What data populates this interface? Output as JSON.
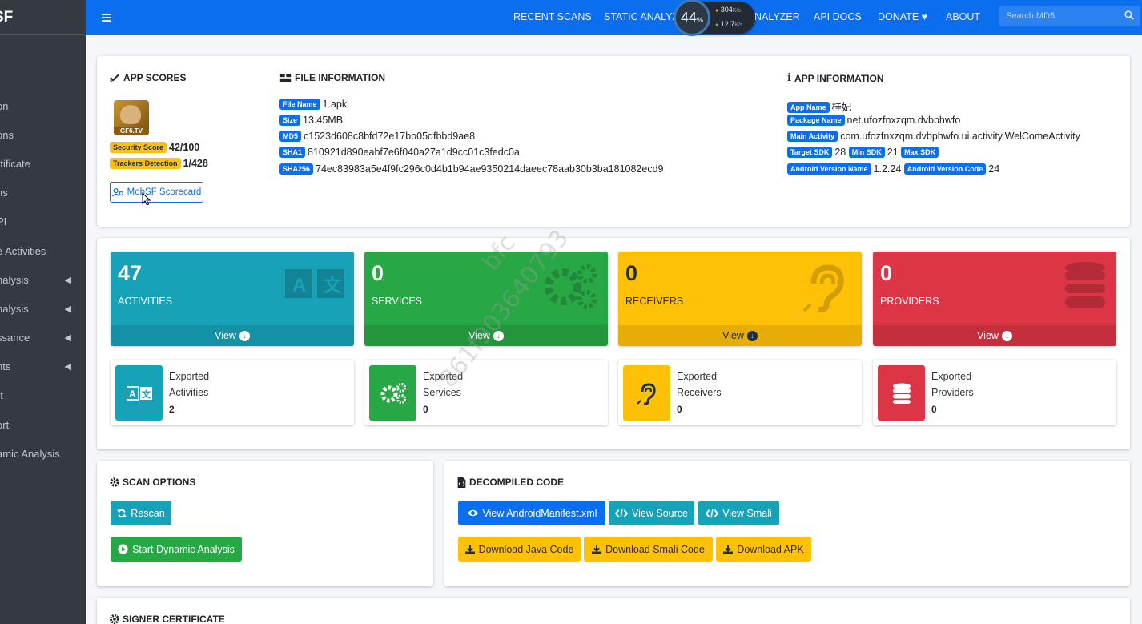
{
  "sidebar": {
    "brand": "SF",
    "items": [
      {
        "label": "on",
        "chevron": false
      },
      {
        "label": "ons",
        "chevron": false
      },
      {
        "label": "rtificate",
        "chevron": false
      },
      {
        "label": "ns",
        "chevron": false
      },
      {
        "label": "PI",
        "chevron": false
      },
      {
        "label": "e Activities",
        "chevron": false
      },
      {
        "label": "nalysis",
        "chevron": true
      },
      {
        "label": "nalysis",
        "chevron": true
      },
      {
        "label": "ssance",
        "chevron": true
      },
      {
        "label": "nts",
        "chevron": true
      },
      {
        "label": "rt",
        "chevron": false
      },
      {
        "label": "ort",
        "chevron": false
      },
      {
        "label": "amic Analysis",
        "chevron": false
      }
    ]
  },
  "topnav": {
    "recent_scans": "RECENT SCANS",
    "static_analyzer": "STATIC ANALYZE",
    "dynamic_analyzer": "NALYZER",
    "api_docs": "API DOCS",
    "donate": "DONATE",
    "about": "ABOUT",
    "search_placeholder": "Search MD5"
  },
  "speed_widget": {
    "percent": "44",
    "percent_unit": "%",
    "up": "304",
    "up_unit": "K/s",
    "down": "12.7",
    "down_unit": "K/s"
  },
  "app_scores": {
    "title": "APP SCORES",
    "icon_text": "GF6.TV",
    "security_label": "Security Score",
    "security_value": "42/100",
    "trackers_label": "Trackers Detection",
    "trackers_value": "1/428",
    "scorecard_button": "MobSF Scorecard"
  },
  "file_info": {
    "title": "FILE INFORMATION",
    "file_name_label": "File Name",
    "file_name": "1.apk",
    "size_label": "Size",
    "size": "13.45MB",
    "md5_label": "MD5",
    "md5": "c1523d608c8bfd72e17bb05dfbbd9ae8",
    "sha1_label": "SHA1",
    "sha1": "810921d890eabf7e6f040a27a1d9cc01c3fedc0a",
    "sha256_label": "SHA256",
    "sha256": "74ec83983a5e4f9fc296c0d4b1b94ae9350214daeec78aab30b3ba181082ecd9"
  },
  "app_info": {
    "title": "APP INFORMATION",
    "app_name_label": "App Name",
    "app_name": "桂妃",
    "package_label": "Package Name",
    "package": "net.ufozfnxzqm.dvbphwfo",
    "main_activity_label": "Main Activity",
    "main_activity": "com.ufozfnxzqm.dvbphwfo.ui.activity.WelComeActivity",
    "target_sdk_label": "Target SDK",
    "target_sdk": "28",
    "min_sdk_label": "Min SDK",
    "min_sdk": "21",
    "max_sdk_label": "Max SDK",
    "max_sdk": "",
    "version_name_label": "Android Version Name",
    "version_name": "1.2.24",
    "version_code_label": "Android Version Code",
    "version_code": "24"
  },
  "components": {
    "view_label": "View",
    "activities": {
      "count": "47",
      "label": "ACTIVITIES",
      "color": "#17a2b8"
    },
    "services": {
      "count": "0",
      "label": "SERVICES",
      "color": "#28a745"
    },
    "receivers": {
      "count": "0",
      "label": "RECEIVERS",
      "color": "#ffc107"
    },
    "providers": {
      "count": "0",
      "label": "PROVIDERS",
      "color": "#dc3545"
    }
  },
  "exported": {
    "label": "Exported",
    "activities": {
      "kind": "Activities",
      "value": "2"
    },
    "services": {
      "kind": "Services",
      "value": "0"
    },
    "receivers": {
      "kind": "Receivers",
      "value": "0"
    },
    "providers": {
      "kind": "Providers",
      "value": "0"
    }
  },
  "scan_options": {
    "title": "SCAN OPTIONS",
    "rescan": "Rescan",
    "start_dynamic": "Start Dynamic Analysis"
  },
  "decompiled": {
    "title": "DECOMPILED CODE",
    "view_manifest": "View AndroidManifest.xml",
    "view_source": "View Source",
    "view_smali": "View Smali",
    "download_java": "Download Java Code",
    "download_smali": "Download Smali Code",
    "download_apk": "Download APK"
  },
  "signer": {
    "title": "SIGNER CERTIFICATE"
  },
  "watermark": {
    "line1": "bfc",
    "line2": "861f903640793"
  }
}
